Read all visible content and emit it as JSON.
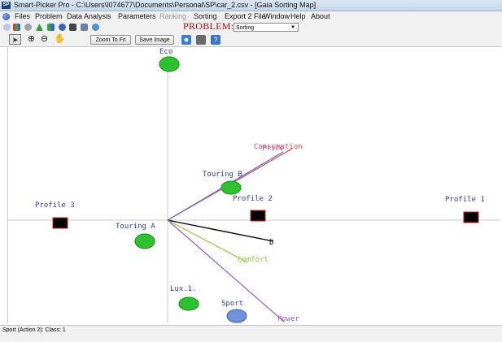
{
  "window": {
    "title": "Smart-Picker Pro  - C:\\Users\\I074677\\Documents\\Personal\\SP\\car_2.csv - [Gaia Sorting Map]",
    "app_icon_text": "SP"
  },
  "menu": [
    {
      "label": "Files",
      "enabled": true
    },
    {
      "label": "Problem",
      "enabled": true
    },
    {
      "label": "Data Analysis",
      "enabled": true
    },
    {
      "label": "Parameters",
      "enabled": true
    },
    {
      "label": "Ranking",
      "enabled": false
    },
    {
      "label": "Sorting",
      "enabled": true
    },
    {
      "label": "Export 2 File",
      "enabled": true
    },
    {
      "label": "Window",
      "enabled": true
    },
    {
      "label": "Help",
      "enabled": true
    },
    {
      "label": "About",
      "enabled": true
    }
  ],
  "problem": {
    "label": "PROBLEM:",
    "selected": "Sorting"
  },
  "tools": {
    "zoom_to_fit": "Zoom To Fit",
    "save_image": "Save Image"
  },
  "map": {
    "axis_label": "Eco",
    "criteria": [
      {
        "name": "Consumption",
        "color": "#e14b4b"
      },
      {
        "name": "Price",
        "color": "#9d5ad0"
      },
      {
        "name": "Comfort",
        "color": "#8fcc3a"
      },
      {
        "name": "D",
        "color": "#000000"
      },
      {
        "name": "Power",
        "color": "#9d5ad0"
      }
    ],
    "actions": [
      {
        "name": "Touring B",
        "color": "#2ec22e"
      },
      {
        "name": "Touring A",
        "color": "#2ec22e"
      },
      {
        "name": "Lux.1.",
        "color": "#2ec22e"
      },
      {
        "name": "Sport",
        "color": "#6f93d9"
      }
    ],
    "profiles": [
      {
        "name": "Profile 1"
      },
      {
        "name": "Profile 2"
      },
      {
        "name": "Profile 3"
      }
    ]
  },
  "status": {
    "text": "Sport (Action 2): Class: 1"
  }
}
